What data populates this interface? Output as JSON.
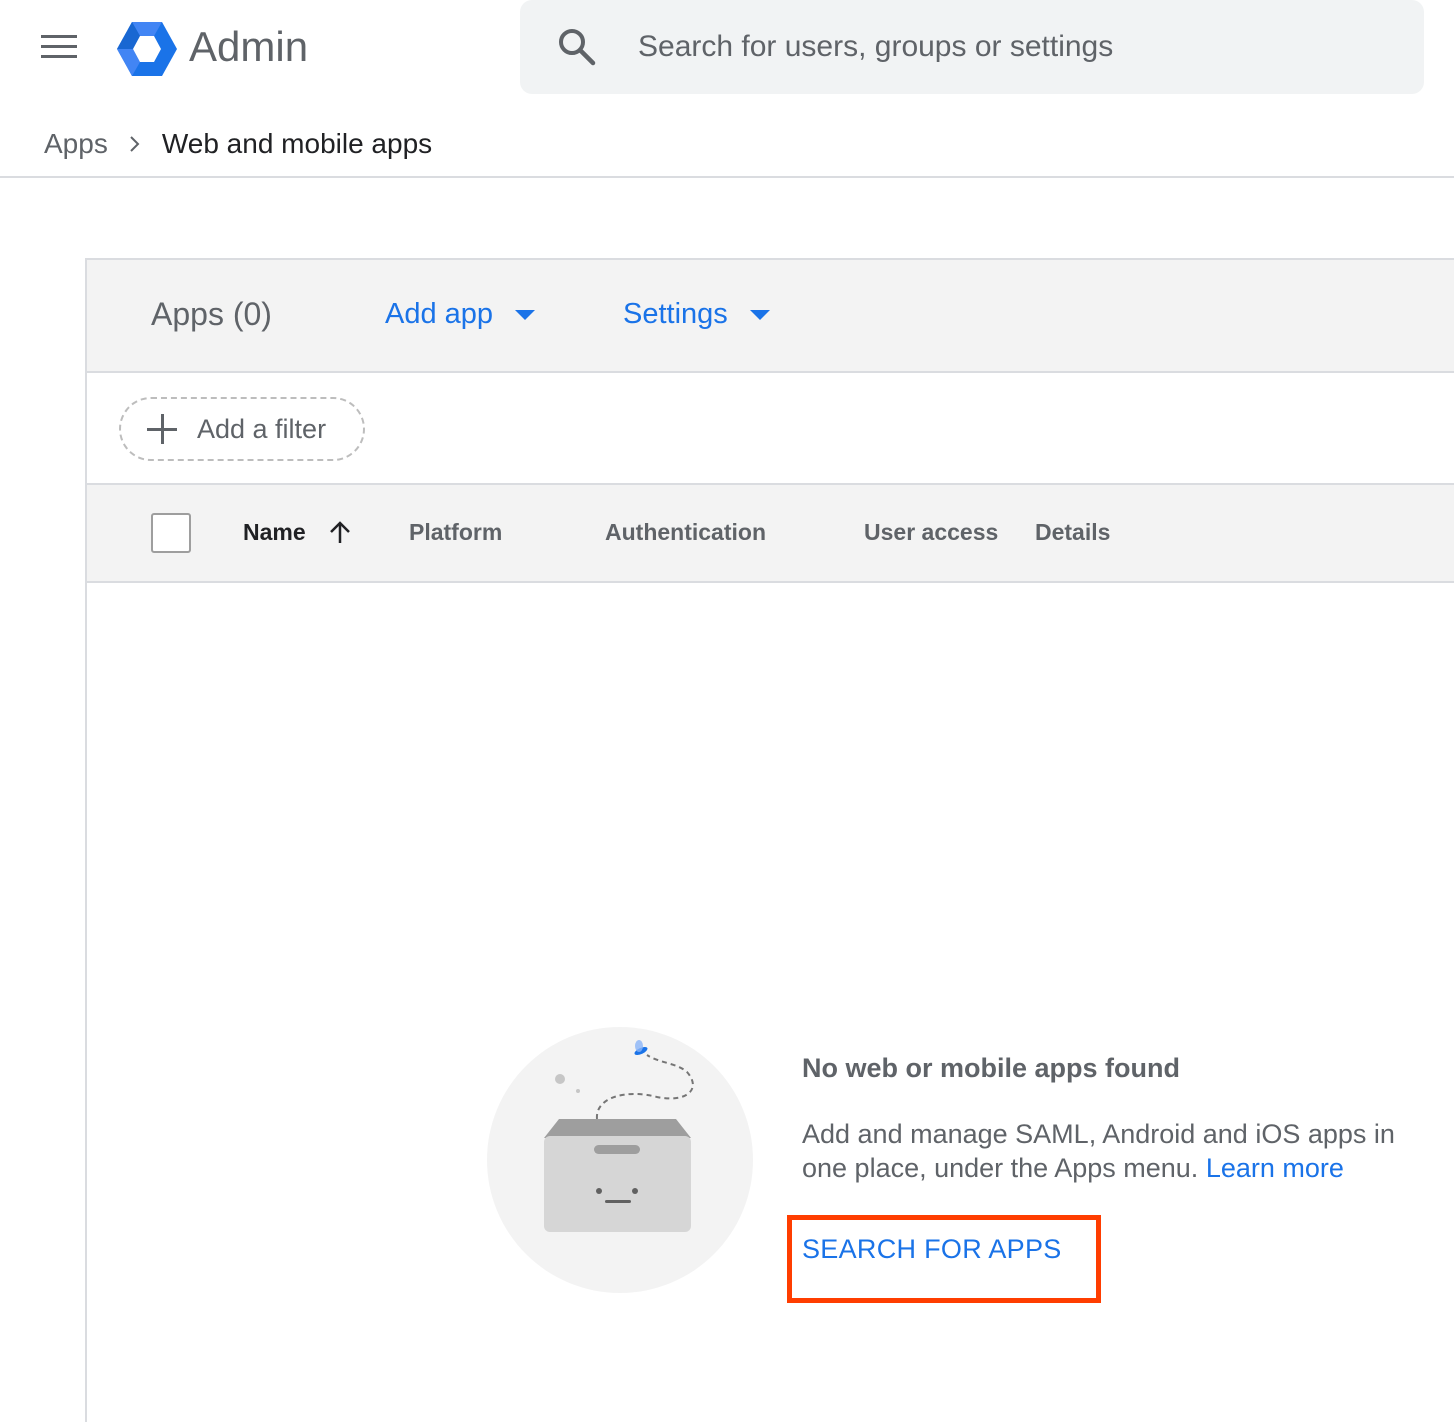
{
  "header": {
    "app_name": "Admin",
    "search_placeholder": "Search for users, groups or settings"
  },
  "breadcrumb": {
    "parent": "Apps",
    "current": "Web and mobile apps"
  },
  "toolbar": {
    "apps_count_label": "Apps (0)",
    "add_app_label": "Add app",
    "settings_label": "Settings"
  },
  "filter": {
    "add_filter_label": "Add a filter"
  },
  "table": {
    "columns": {
      "name": "Name",
      "platform": "Platform",
      "authentication": "Authentication",
      "user_access": "User access",
      "details": "Details"
    },
    "sort": "ascending"
  },
  "empty_state": {
    "title": "No web or mobile apps found",
    "description": "Add and manage SAML, Android and iOS apps in one place, under the Apps menu.",
    "learn_more": "Learn more",
    "action_label": "SEARCH FOR APPS"
  },
  "colors": {
    "accent": "#1a73e8",
    "highlight": "#ff3d00"
  },
  "icons": [
    "menu-icon",
    "admin-logo-icon",
    "search-icon",
    "chevron-right-icon",
    "caret-down-icon",
    "plus-icon",
    "arrow-up-icon",
    "empty-box-illustration"
  ]
}
